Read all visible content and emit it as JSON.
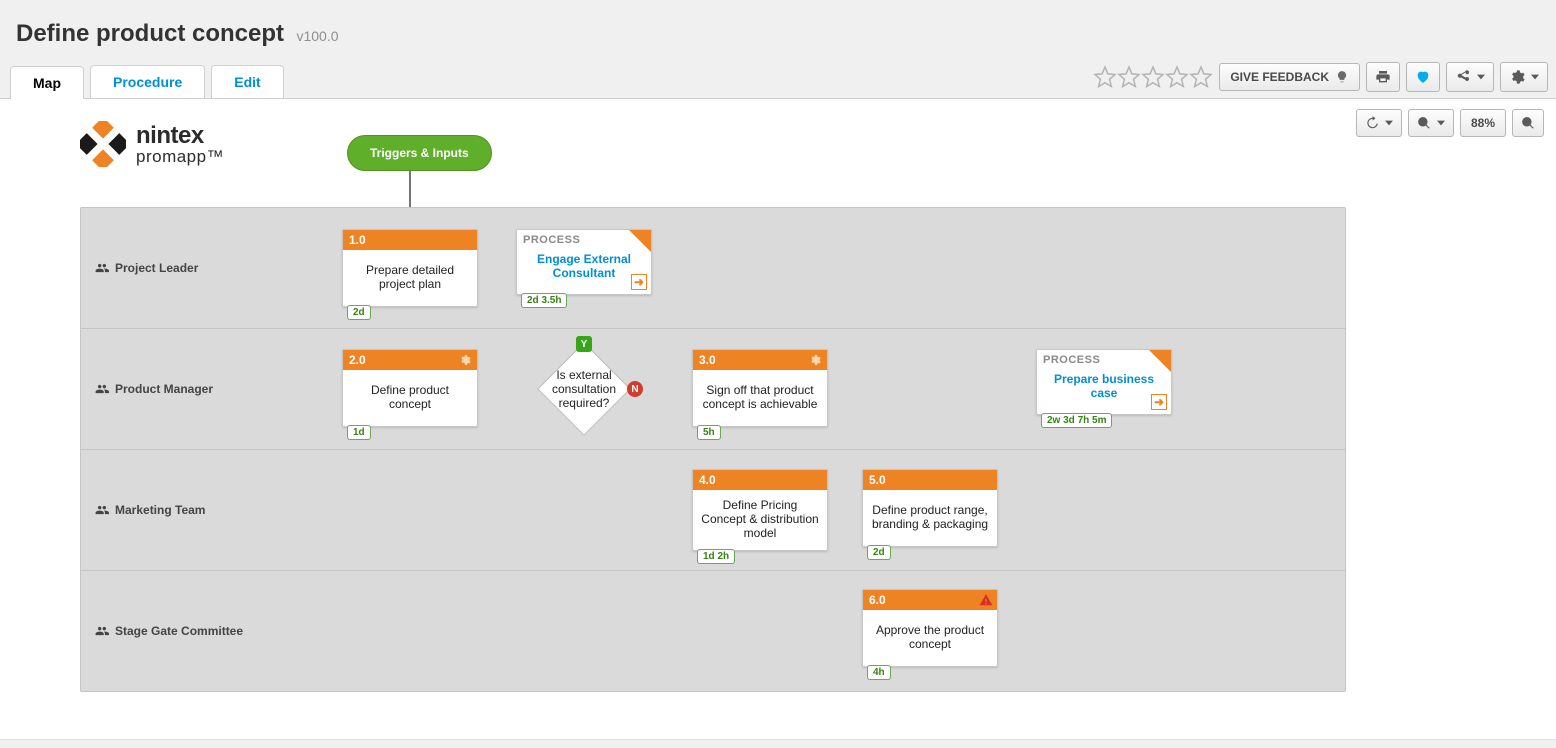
{
  "title": "Define product concept",
  "version": "v100.0",
  "tabs": [
    "Map",
    "Procedure",
    "Edit"
  ],
  "active_tab": 0,
  "feedback_button": "GIVE FEEDBACK",
  "zoom": "88%",
  "logo": {
    "line1": "nintex",
    "line2": "promapp",
    "tm": "™"
  },
  "trigger": "Triggers & Inputs",
  "lanes": [
    "Project Leader",
    "Product Manager",
    "Marketing Team",
    "Stage Gate Committee"
  ],
  "activities": {
    "a1": {
      "num": "1.0",
      "title": "Prepare detailed project plan",
      "dur": "2d"
    },
    "a2": {
      "num": "2.0",
      "title": "Define product concept",
      "dur": "1d"
    },
    "a3": {
      "num": "3.0",
      "title": "Sign off that product concept is achievable",
      "dur": "5h"
    },
    "a4": {
      "num": "4.0",
      "title": "Define Pricing Concept & distribution model",
      "dur": "1d 2h"
    },
    "a5": {
      "num": "5.0",
      "title": "Define product range, branding & packaging",
      "dur": "2d"
    },
    "a6": {
      "num": "6.0",
      "title": "Approve the product concept",
      "dur": "4h"
    }
  },
  "decision": {
    "text": "Is external consultation required?",
    "yes": "Y",
    "no": "N"
  },
  "processes": {
    "p1": {
      "label": "PROCESS",
      "title": "Engage External Consultant",
      "dur": "2d 3.5h"
    },
    "p2": {
      "label": "PROCESS",
      "title": "Prepare business case",
      "dur": "2w 3d 7h 5m"
    }
  },
  "colors": {
    "orange": "#ed8323",
    "green": "#5ea82b",
    "link": "#008fd4"
  }
}
